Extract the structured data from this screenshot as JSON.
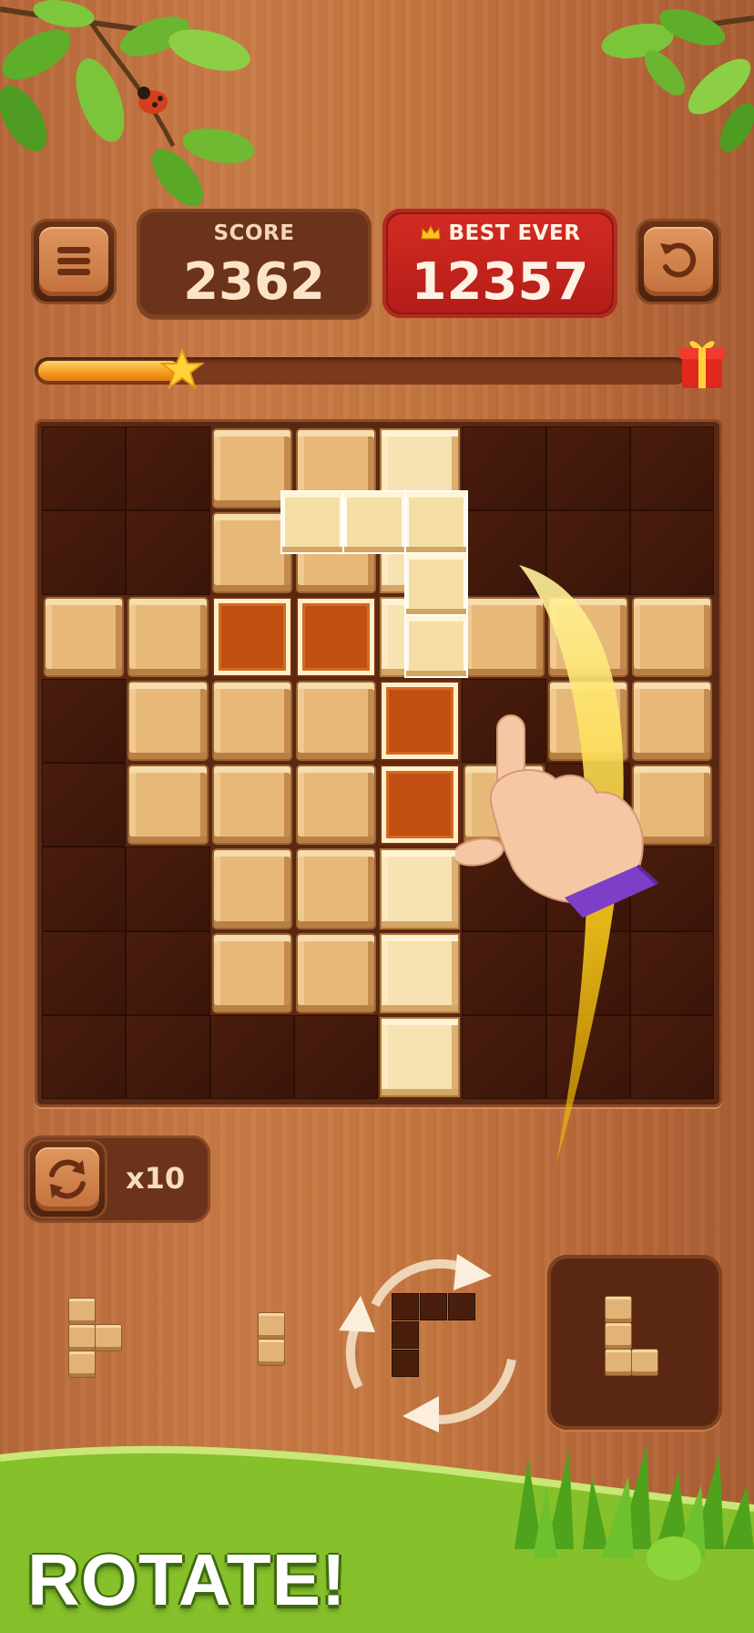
{
  "score": {
    "label": "SCORE",
    "value": "2362"
  },
  "best": {
    "label": "BEST EVER",
    "value": "12357"
  },
  "level_progress": 0.22,
  "board": {
    "size": 8,
    "cells": [
      "DDLLGDDD",
      "DDLLGDDD",
      "LLOOGLLL",
      "DLLLODLL",
      "DLLLOLDL",
      "DDLLGDDD",
      "DDLLGDDD",
      "DDDDGDDD"
    ],
    "dragging_piece": [
      [
        2,
        3
      ],
      [
        2,
        4
      ],
      [
        2,
        5
      ],
      [
        3,
        5
      ],
      [
        4,
        5
      ]
    ]
  },
  "rotate_powerup": {
    "count": "x10"
  },
  "tray": {
    "pieces": [
      {
        "name": "t-piece",
        "cells": [
          [
            0,
            0
          ],
          [
            1,
            0
          ],
          [
            1,
            1
          ],
          [
            2,
            0
          ]
        ]
      },
      {
        "name": "i2-piece",
        "cells": [
          [
            0,
            0
          ],
          [
            1,
            0
          ]
        ]
      },
      {
        "name": "rotating-piece",
        "cells": [
          [
            0,
            0
          ],
          [
            0,
            1
          ],
          [
            0,
            2
          ],
          [
            1,
            0
          ],
          [
            2,
            0
          ]
        ]
      },
      {
        "name": "l-piece",
        "cells": [
          [
            0,
            0
          ],
          [
            1,
            0
          ],
          [
            2,
            0
          ],
          [
            2,
            1
          ]
        ]
      }
    ]
  },
  "banner": {
    "text": "ROTATE!"
  },
  "colors": {
    "accent_red": "#c9231c",
    "wood": "#c5773f",
    "grass": "#86c02a"
  },
  "icons": [
    "menu-icon",
    "crown-icon",
    "undo-icon",
    "star-icon",
    "gift-icon",
    "rotate-icon",
    "hand-pointer-icon",
    "rotate-arrows-icon",
    "ladybug-icon"
  ]
}
